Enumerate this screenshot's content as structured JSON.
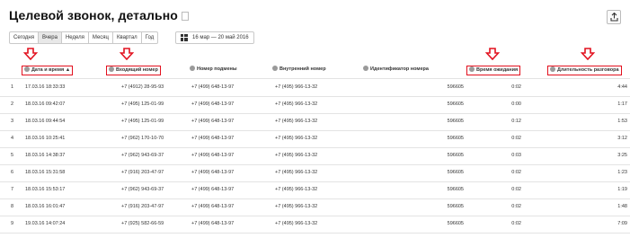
{
  "title": "Целевой звонок, детально",
  "periods": [
    {
      "label": "Сегодня",
      "active": false
    },
    {
      "label": "Вчера",
      "active": true
    },
    {
      "label": "Неделя",
      "active": false
    },
    {
      "label": "Месяц",
      "active": false
    },
    {
      "label": "Квартал",
      "active": false
    },
    {
      "label": "Год",
      "active": false
    }
  ],
  "date_range": "16 мар — 20 май 2016",
  "columns": [
    {
      "label": "Дата и время",
      "sort": "▲",
      "highlighted": true
    },
    {
      "label": "Входящий номер",
      "highlighted": true
    },
    {
      "label": "Номер подмены",
      "highlighted": false
    },
    {
      "label": "Внутренний номер",
      "highlighted": false
    },
    {
      "label": "Идентификатор номера",
      "highlighted": false
    },
    {
      "label": "Время ожидания",
      "highlighted": true
    },
    {
      "label": "Длительность разговора",
      "highlighted": true
    }
  ],
  "rows": [
    {
      "n": "1",
      "dt": "17.03.16 18:33:33",
      "in": "+7 (4912) 28-95-93",
      "sub": "+7 (499) 648-13-97",
      "int": "+7 (495) 966-13-32",
      "id": "596605",
      "wait": "0:02",
      "dur": "4:44"
    },
    {
      "n": "2",
      "dt": "18.03.16 09:42:07",
      "in": "+7 (495) 125-01-99",
      "sub": "+7 (499) 648-13-97",
      "int": "+7 (495) 966-13-32",
      "id": "596605",
      "wait": "0:00",
      "dur": "1:17"
    },
    {
      "n": "3",
      "dt": "18.03.16 09:44:54",
      "in": "+7 (495) 125-01-99",
      "sub": "+7 (499) 648-13-97",
      "int": "+7 (495) 966-13-32",
      "id": "596605",
      "wait": "0:12",
      "dur": "1:53"
    },
    {
      "n": "4",
      "dt": "18.03.16 10:25:41",
      "in": "+7 (962) 170-10-70",
      "sub": "+7 (499) 648-13-97",
      "int": "+7 (495) 966-13-32",
      "id": "596605",
      "wait": "0:02",
      "dur": "3:12"
    },
    {
      "n": "5",
      "dt": "18.03.16 14:38:37",
      "in": "+7 (962) 943-69-37",
      "sub": "+7 (499) 648-13-97",
      "int": "+7 (495) 966-13-32",
      "id": "596605",
      "wait": "0:03",
      "dur": "3:25"
    },
    {
      "n": "6",
      "dt": "18.03.16 15:31:58",
      "in": "+7 (916) 203-47-97",
      "sub": "+7 (499) 648-13-97",
      "int": "+7 (495) 966-13-32",
      "id": "596605",
      "wait": "0:02",
      "dur": "1:23"
    },
    {
      "n": "7",
      "dt": "18.03.16 15:53:17",
      "in": "+7 (962) 943-69-37",
      "sub": "+7 (499) 648-13-97",
      "int": "+7 (495) 966-13-32",
      "id": "596605",
      "wait": "0:02",
      "dur": "1:19"
    },
    {
      "n": "8",
      "dt": "18.03.16 16:01:47",
      "in": "+7 (916) 203-47-97",
      "sub": "+7 (499) 648-13-97",
      "int": "+7 (495) 966-13-32",
      "id": "596605",
      "wait": "0:02",
      "dur": "1:48"
    },
    {
      "n": "9",
      "dt": "19.03.16 14:07:24",
      "in": "+7 (925) 582-66-59",
      "sub": "+7 (499) 648-13-97",
      "int": "+7 (495) 966-13-32",
      "id": "596605",
      "wait": "0:02",
      "dur": "7:09"
    }
  ],
  "colors": {
    "highlight": "#e2101e",
    "divider": "#e3e3e3",
    "active_period": "#e8e8e8"
  }
}
